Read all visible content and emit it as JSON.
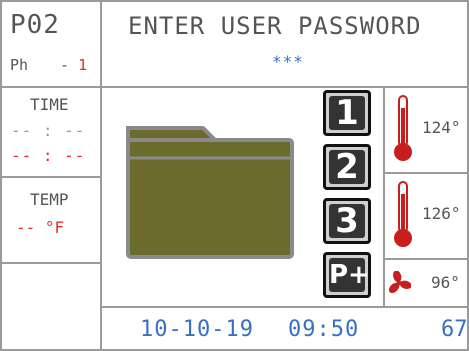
{
  "left_panel": {
    "program": "P02",
    "phase_label": "Ph",
    "phase_dash": "-",
    "phase_value": "1",
    "time_label": "TIME",
    "time_line_1": "-- : --",
    "time_line_2": "-- : --",
    "temp_label": "TEMP",
    "temp_value": "-- °F"
  },
  "header": {
    "prompt": "ENTER USER PASSWORD",
    "password_mask": "***"
  },
  "steps": [
    {
      "label": "1"
    },
    {
      "label": "2"
    },
    {
      "label": "3"
    },
    {
      "label": "P+"
    }
  ],
  "right_panel": {
    "sensor_1_value": "124°",
    "sensor_2_value": "126°",
    "fan_value": "96°"
  },
  "status_bar": {
    "date": "10-10-19",
    "time": "09:50",
    "counter": "67"
  },
  "colors": {
    "folder_fill": "#6b6c2c",
    "folder_border": "#8a8a8a",
    "accent_blue": "#3a6fc4",
    "alert_red": "#e03030",
    "thermometer_red": "#c81e1e"
  }
}
